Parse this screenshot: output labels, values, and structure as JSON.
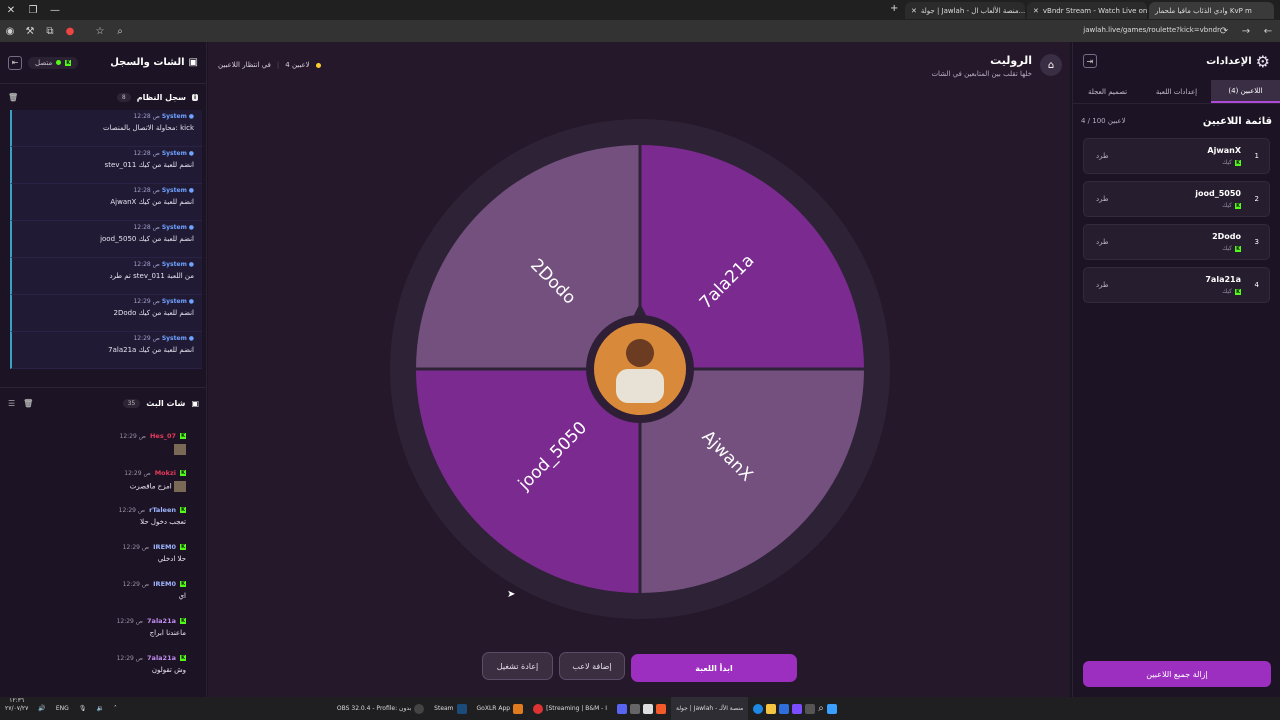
{
  "browser": {
    "tabs": [
      {
        "label": "وادي الذئاب مافيا ملحمار KvP m"
      },
      {
        "label": "vBndr Stream - Watch Live on"
      },
      {
        "label": "جولة | Jawlah - منصة الألعاب ال..."
      }
    ],
    "url": "jawlah.live/games/roulette?kick=vbndr"
  },
  "chat_panel": {
    "title": "الشات والسجل",
    "status": "متصل",
    "system_log_title": "سجل النظام",
    "system_log_count": "8",
    "system_entries": [
      {
        "user": "System",
        "time": "12:28 ص",
        "text": "محاولة الاتصال بالمنصات: kick"
      },
      {
        "user": "System",
        "time": "12:28 ص",
        "text": "stev_011 انضم للعبة من كيك"
      },
      {
        "user": "System",
        "time": "12:28 ص",
        "text": "AjwanX انضم للعبة من كيك"
      },
      {
        "user": "System",
        "time": "12:28 ص",
        "text": "jood_5050 انضم للعبة من كيك"
      },
      {
        "user": "System",
        "time": "12:28 ص",
        "text": "تم طرد stev_011 من اللعبة"
      },
      {
        "user": "System",
        "time": "12:29 ص",
        "text": "2Dodo انضم للعبة من كيك"
      },
      {
        "user": "System",
        "time": "12:29 ص",
        "text": "7ala21a انضم للعبة من كيك"
      }
    ],
    "live_chat_title": "شات البث",
    "live_chat_count": "35",
    "chat_entries": [
      {
        "user": "Hes_07",
        "time": "12:29 ص",
        "text": "",
        "color": "#e83a5a",
        "emote": true
      },
      {
        "user": "Mokzi",
        "time": "12:29 ص",
        "text": "امزح ماقصرت",
        "color": "#e83a5a",
        "emote": true
      },
      {
        "user": "rTaleen",
        "time": "12:29 ص",
        "text": "تعجب دخول حلا",
        "color": "#9fb4ff",
        "emote": false
      },
      {
        "user": "IREM0",
        "time": "12:29 ص",
        "text": "حلا ادخلي",
        "color": "#9fb4ff",
        "emote": false
      },
      {
        "user": "IREM0",
        "time": "12:29 ص",
        "text": "اي",
        "color": "#9fb4ff",
        "emote": false
      },
      {
        "user": "7ala21a",
        "time": "12:29 ص",
        "text": "ماعندنا ابراج",
        "color": "#c28cf0",
        "emote": false
      },
      {
        "user": "7ala21a",
        "time": "12:29 ص",
        "text": "وش تقولون",
        "color": "#c28cf0",
        "emote": false
      }
    ]
  },
  "main": {
    "title": "الروليت",
    "subtitle": "خلها تقلب بين المتابعين في الشات",
    "players_count": "4 لاعبين",
    "waiting": "في انتظار اللاعبين",
    "wheel_segments": [
      {
        "label": "7ala21a",
        "color": "#7b2a90"
      },
      {
        "label": "AjwanX",
        "color": "#74507f"
      },
      {
        "label": "jood_5050",
        "color": "#7b2a90"
      },
      {
        "label": "2Dodo",
        "color": "#74507f"
      }
    ],
    "buttons": {
      "start": "ابدأ اللعبة",
      "add_player": "إضافة لاعب",
      "restart": "إعادة تشغيل"
    }
  },
  "settings_panel": {
    "title": "الإعدادات",
    "tabs": [
      "اللاعبين (4)",
      "إعدادات اللعبة",
      "تصميم العجلة"
    ],
    "list_title": "قائمة اللاعبين",
    "list_count": "4 / 100 لاعبين",
    "players": [
      {
        "num": "1",
        "name": "AjwanX",
        "platform": "كيك",
        "kick": "طرد"
      },
      {
        "num": "2",
        "name": "jood_5050",
        "platform": "كيك",
        "kick": "طرد"
      },
      {
        "num": "3",
        "name": "2Dodo",
        "platform": "كيك",
        "kick": "طرد"
      },
      {
        "num": "4",
        "name": "7ala21a",
        "platform": "كيك",
        "kick": "طرد"
      }
    ],
    "remove_all": "إزالة جميع اللاعبين"
  },
  "taskbar": {
    "lang": "ENG",
    "date_a": "١٢:٣٦",
    "date_b": "٢٧/٠٧/٢٧",
    "items": [
      "OBS 32.0.4 - Profile: بدون",
      "Steam",
      "GoXLR App",
      "[Streaming | B&M - I",
      "جولة | Jawlah - منصة الألـ"
    ]
  }
}
